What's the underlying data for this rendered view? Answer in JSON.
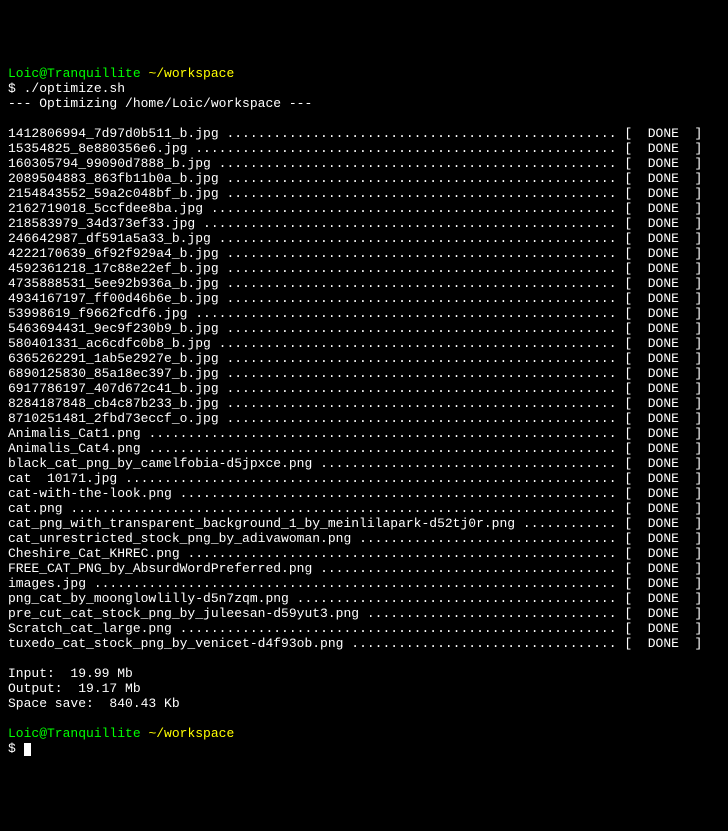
{
  "prompt1": {
    "userhost": "Loic@Tranquillite",
    "path": "~/workspace",
    "command": "./optimize.sh"
  },
  "header": "--- Optimizing /home/Loic/workspace ---",
  "status_label": "DONE",
  "files": [
    "1412806994_7d97d0b511_b.jpg",
    "15354825_8e880356e6.jpg",
    "160305794_99090d7888_b.jpg",
    "2089504883_863fb11b0a_b.jpg",
    "2154843552_59a2c048bf_b.jpg",
    "2162719018_5ccfdee8ba.jpg",
    "218583979_34d373ef33.jpg",
    "246642987_df591a5a33_b.jpg",
    "4222170639_6f92f929a4_b.jpg",
    "4592361218_17c88e22ef_b.jpg",
    "4735888531_5ee92b936a_b.jpg",
    "4934167197_ff00d46b6e_b.jpg",
    "53998619_f9662fcdf6.jpg",
    "5463694431_9ec9f230b9_b.jpg",
    "580401331_ac6cdfc0b8_b.jpg",
    "6365262291_1ab5e2927e_b.jpg",
    "6890125830_85a18ec397_b.jpg",
    "6917786197_407d672c41_b.jpg",
    "8284187848_cb4c87b233_b.jpg",
    "8710251481_2fbd73eccf_o.jpg",
    "Animalis_Cat1.png",
    "Animalis_Cat4.png",
    "black_cat_png_by_camelfobia-d5jpxce.png",
    "cat  10171.jpg",
    "cat-with-the-look.png",
    "cat.png",
    "cat_png_with_transparent_background_1_by_meinlilapark-d52tj0r.png",
    "cat_unrestricted_stock_png_by_adivawoman.png",
    "Cheshire_Cat_KHREC.png",
    "FREE_CAT_PNG_by_AbsurdWordPreferred.png",
    "images.jpg",
    "png_cat_by_moonglowlilly-d5n7zqm.png",
    "pre_cut_cat_stock_png_by_juleesan-d59yut3.png",
    "Scratch_cat_large.png",
    "tuxedo_cat_stock_png_by_venicet-d4f93ob.png"
  ],
  "summary": {
    "input_label": "Input:",
    "input_value": "19.99 Mb",
    "output_label": "Output:",
    "output_value": "19.17 Mb",
    "save_label": "Space save:",
    "save_value": "840.43 Kb"
  },
  "prompt2": {
    "userhost": "Loic@Tranquillite",
    "path": "~/workspace"
  }
}
